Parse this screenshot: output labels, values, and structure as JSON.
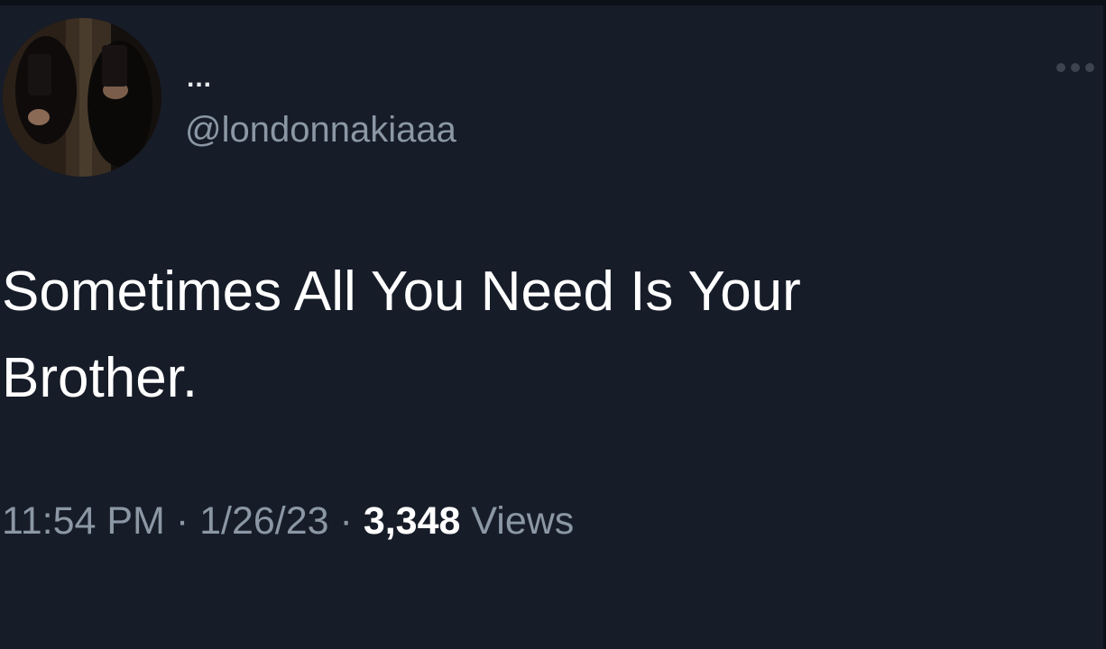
{
  "tweet": {
    "display_name": "...",
    "handle": "@londonnakiaaa",
    "text": "Sometimes All You Need Is Your Brother.",
    "time": "11:54 PM",
    "separator": "·",
    "date": "1/26/23",
    "views_count": "3,348",
    "views_label": "Views"
  },
  "icons": {
    "more": "more-horizontal-icon",
    "avatar": "profile-avatar"
  }
}
